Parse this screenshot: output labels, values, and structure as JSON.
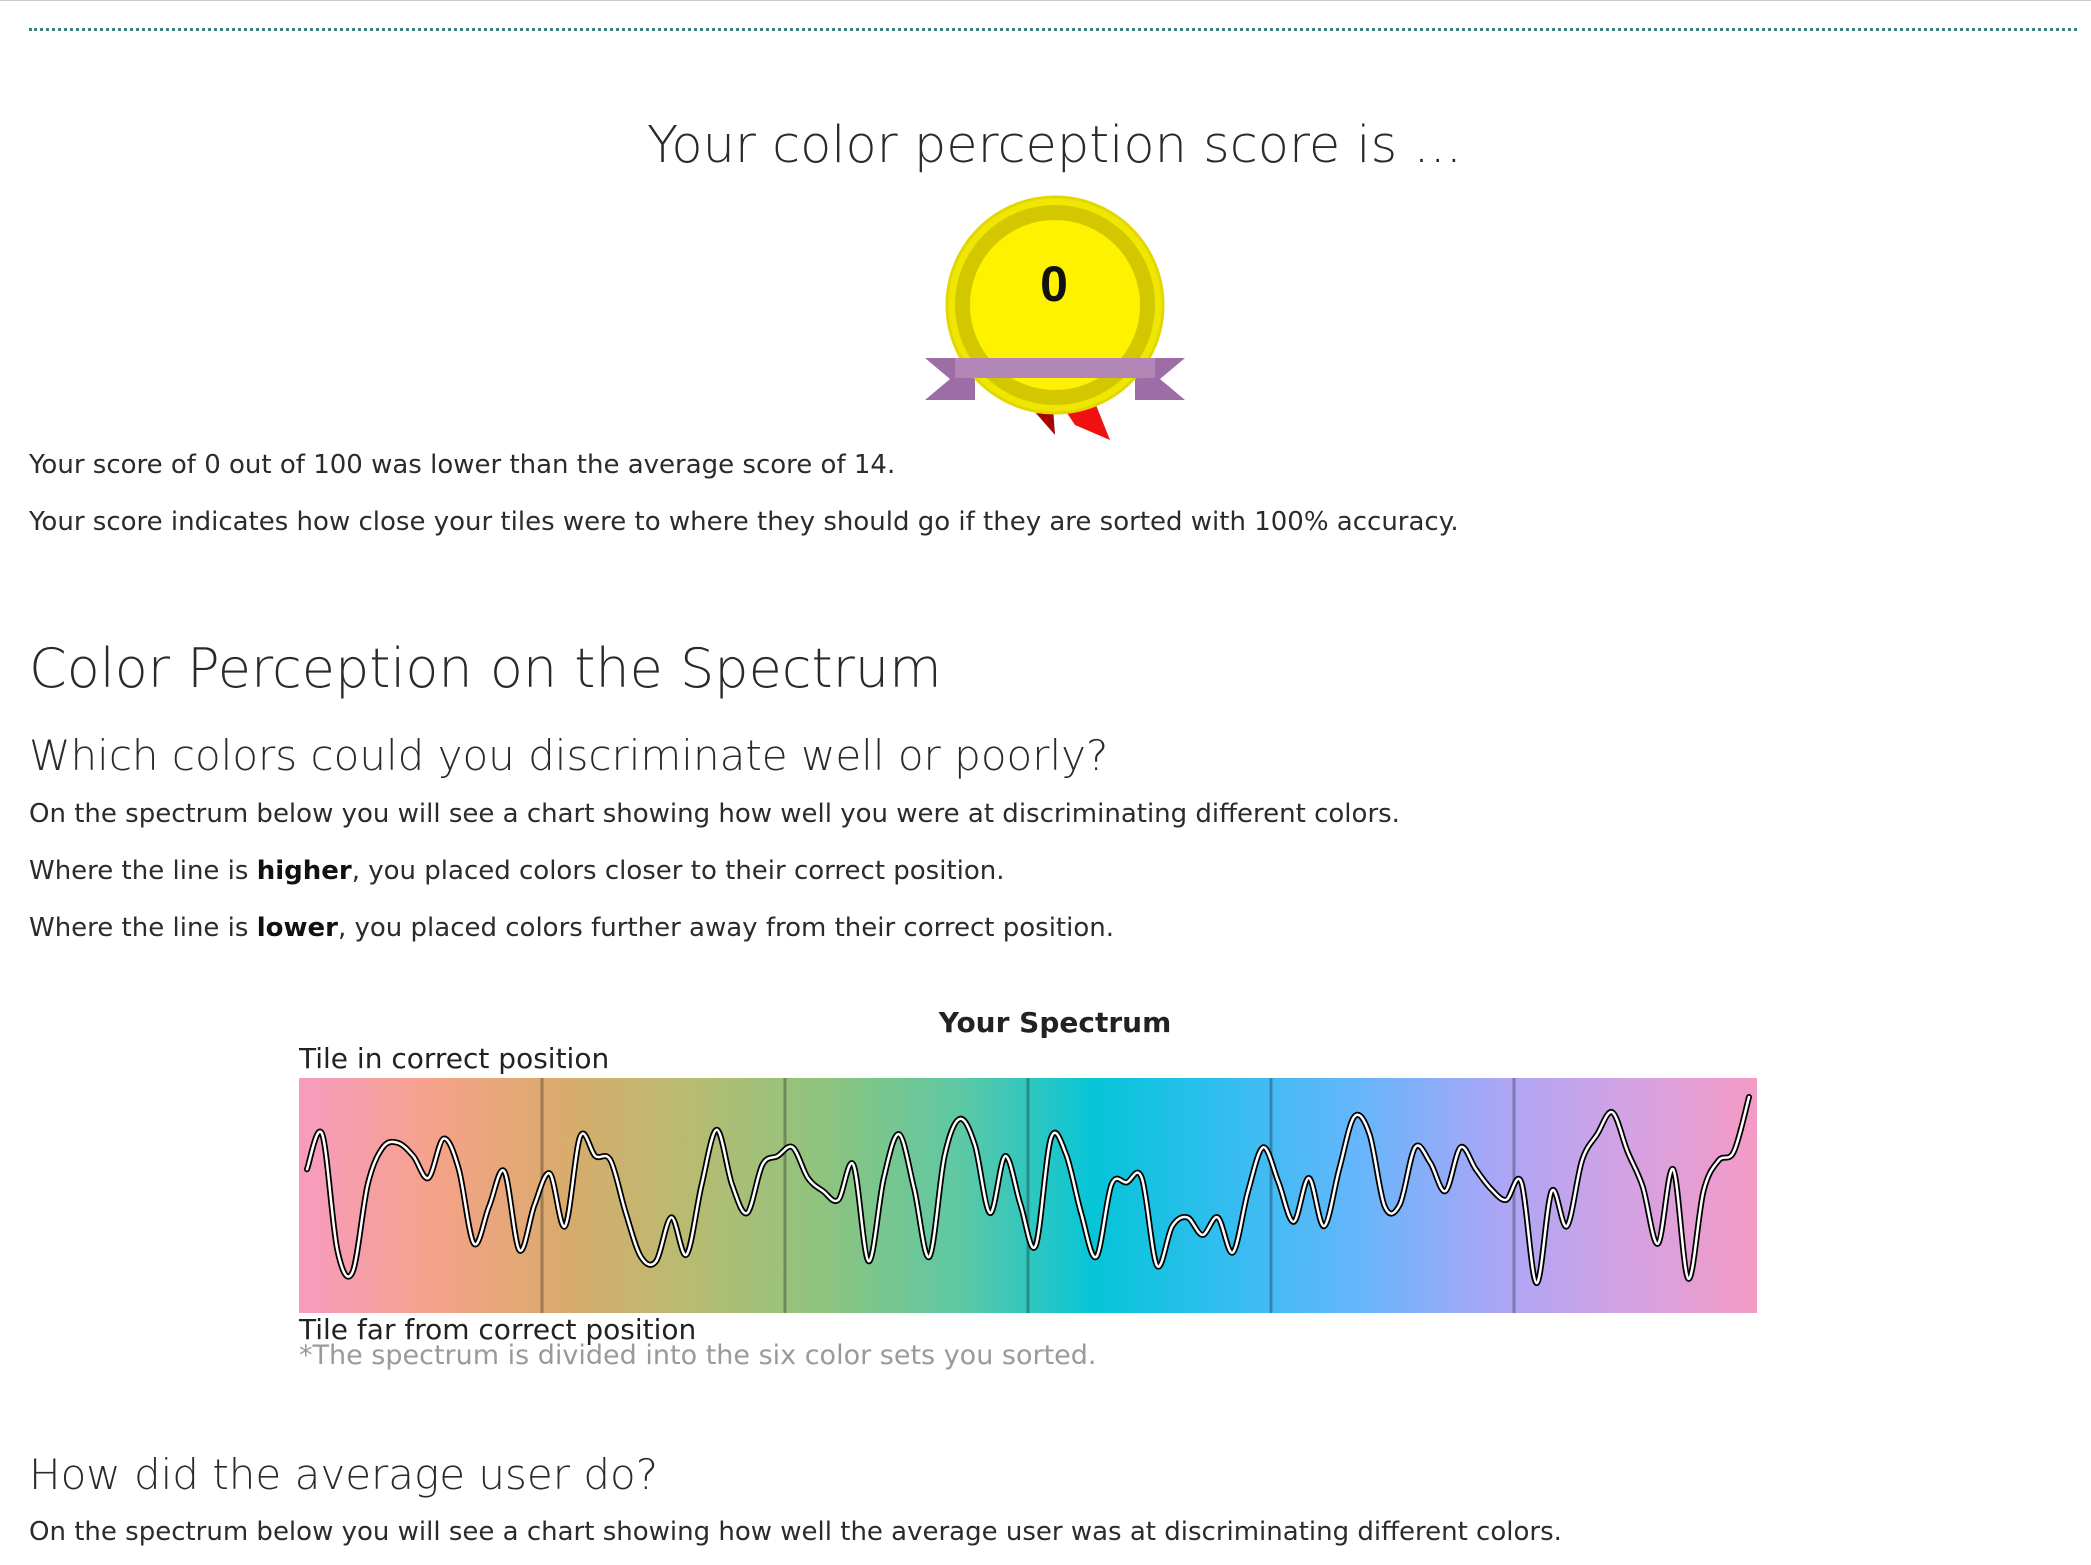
{
  "score_section": {
    "heading": "Your color perception score is ...",
    "medal_value": "0",
    "summary_line": "Your score of 0 out of 100 was lower than the average score of 14.",
    "explanation_line": "Your score indicates how close your tiles were to where they should go if they are sorted with 100% accuracy."
  },
  "spectrum_section": {
    "title": "Color Perception on the Spectrum",
    "subtitle": "Which colors could you discriminate well or poorly?",
    "intro": "On the spectrum below you will see a chart showing how well you were at discriminating different colors.",
    "higher_prefix": "Where the line is ",
    "higher_word": "higher",
    "higher_suffix": ", you placed colors closer to their correct position.",
    "lower_prefix": "Where the line is ",
    "lower_word": "lower",
    "lower_suffix": ", you placed colors further away from their correct position."
  },
  "average_section": {
    "title": "How did the average user do?",
    "intro": "On the spectrum below you will see a chart showing how well the average user was at discriminating different colors."
  },
  "chart_data": {
    "type": "line",
    "title": "Your Spectrum",
    "ylabel_top": "Tile in correct position",
    "ylabel_bottom": "Tile far from correct position",
    "note": "*The spectrum is divided into the six color sets you sorted.",
    "ylim": [
      0,
      1
    ],
    "color_sets": 6,
    "grid": false,
    "background_gradient": [
      "#f79bc0",
      "#f6a28a",
      "#d9ab6c",
      "#b6bc72",
      "#8cc47f",
      "#5dc8a5",
      "#05c5d8",
      "#33bdf0",
      "#66b6fb",
      "#a9a6f7",
      "#d3a2e4",
      "#f59ac5"
    ],
    "y": [
      0.62,
      0.78,
      0.25,
      0.15,
      0.55,
      0.72,
      0.74,
      0.68,
      0.58,
      0.76,
      0.62,
      0.28,
      0.45,
      0.61,
      0.25,
      0.46,
      0.6,
      0.36,
      0.77,
      0.68,
      0.66,
      0.42,
      0.22,
      0.2,
      0.4,
      0.23,
      0.55,
      0.8,
      0.55,
      0.42,
      0.64,
      0.68,
      0.72,
      0.58,
      0.52,
      0.48,
      0.64,
      0.2,
      0.58,
      0.78,
      0.53,
      0.22,
      0.68,
      0.85,
      0.73,
      0.42,
      0.68,
      0.46,
      0.27,
      0.76,
      0.69,
      0.42,
      0.22,
      0.55,
      0.56,
      0.58,
      0.18,
      0.36,
      0.4,
      0.32,
      0.4,
      0.24,
      0.52,
      0.72,
      0.56,
      0.38,
      0.58,
      0.36,
      0.62,
      0.86,
      0.78,
      0.45,
      0.46,
      0.72,
      0.65,
      0.52,
      0.72,
      0.62,
      0.53,
      0.48,
      0.56,
      0.1,
      0.52,
      0.36,
      0.66,
      0.78,
      0.88,
      0.7,
      0.54,
      0.28,
      0.62,
      0.12,
      0.52,
      0.66,
      0.7,
      0.95
    ]
  }
}
